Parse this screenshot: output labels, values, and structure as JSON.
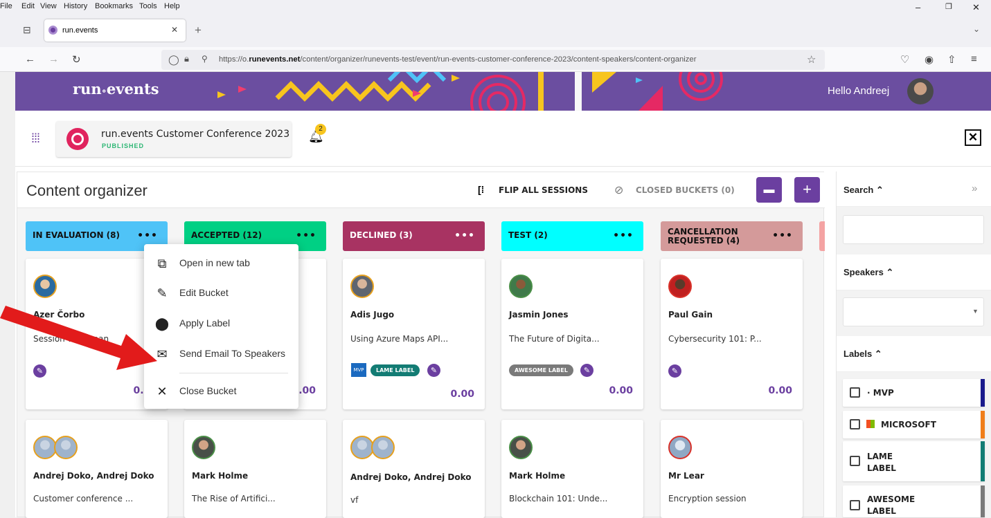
{
  "browser": {
    "menu": [
      "File",
      "Edit",
      "View",
      "History",
      "Bookmarks",
      "Tools",
      "Help"
    ],
    "tab_title": "run.events",
    "url_prefix": "https://o.",
    "url_domain": "runevents.net",
    "url_path": "/content/organizer/runevents-test/event/run-events-customer-conference-2023/content-speakers/content-organizer"
  },
  "banner": {
    "logo": "run events",
    "greeting": "Hello Andreej"
  },
  "event": {
    "title": "run.events Customer Conference 2023",
    "status": "PUBLISHED",
    "notification_count": "2"
  },
  "organizer": {
    "title": "Content organizer",
    "flip_label": "FLIP ALL SESSIONS",
    "closed_label": "CLOSED BUCKETS (0)",
    "columns": [
      {
        "title": "IN EVALUATION (8)",
        "color": "#4fc3f7"
      },
      {
        "title": "ACCEPTED (12)",
        "color": "#00d084"
      },
      {
        "title": "DECLINED (3)",
        "color": "#a83362"
      },
      {
        "title": "TEST (2)",
        "color": "#00ffff"
      },
      {
        "title": "CANCELLATION REQUESTED (4)",
        "color": "#d49a9a"
      }
    ],
    "cards_row1": [
      {
        "speaker": "Azer Čorbo",
        "session": "Session with Iman",
        "score": "0.00"
      },
      {
        "speaker": "",
        "session": "",
        "score": "0.00"
      },
      {
        "speaker": "Adis Jugo",
        "session": "Using Azure Maps API...",
        "score": "0.00",
        "label": "LAME LABEL"
      },
      {
        "speaker": "Jasmin Jones",
        "session": "The Future of Digita...",
        "score": "0.00",
        "label": "AWESOME LABEL"
      },
      {
        "speaker": "Paul Gain",
        "session": "Cybersecurity 101: P...",
        "score": "0.00"
      }
    ],
    "cards_row2": [
      {
        "speaker": "Andrej Doko, Andrej Doko",
        "session": "Customer conference ..."
      },
      {
        "speaker": "Mark Holme",
        "session": "The Rise of Artifici..."
      },
      {
        "speaker": "Andrej Doko, Andrej Doko",
        "session": "vf"
      },
      {
        "speaker": "Mark Holme",
        "session": "Blockchain 101: Unde..."
      },
      {
        "speaker": "Mr Lear",
        "session": "Encryption session"
      }
    ]
  },
  "menu": {
    "items": [
      "Open in new tab",
      "Edit Bucket",
      "Apply Label",
      "Send Email To Speakers",
      "Close Bucket"
    ]
  },
  "sidebar": {
    "search_title": "Search",
    "speakers_title": "Speakers",
    "labels_title": "Labels",
    "labels": [
      {
        "name": "MVP",
        "color": "#1a1a8c"
      },
      {
        "name": "MICROSOFT",
        "color": "#f07d1a"
      },
      {
        "name": "LAME LABEL",
        "color": "#137c74"
      },
      {
        "name": "AWESOME LABEL",
        "color": "#7a7a7a"
      }
    ]
  }
}
